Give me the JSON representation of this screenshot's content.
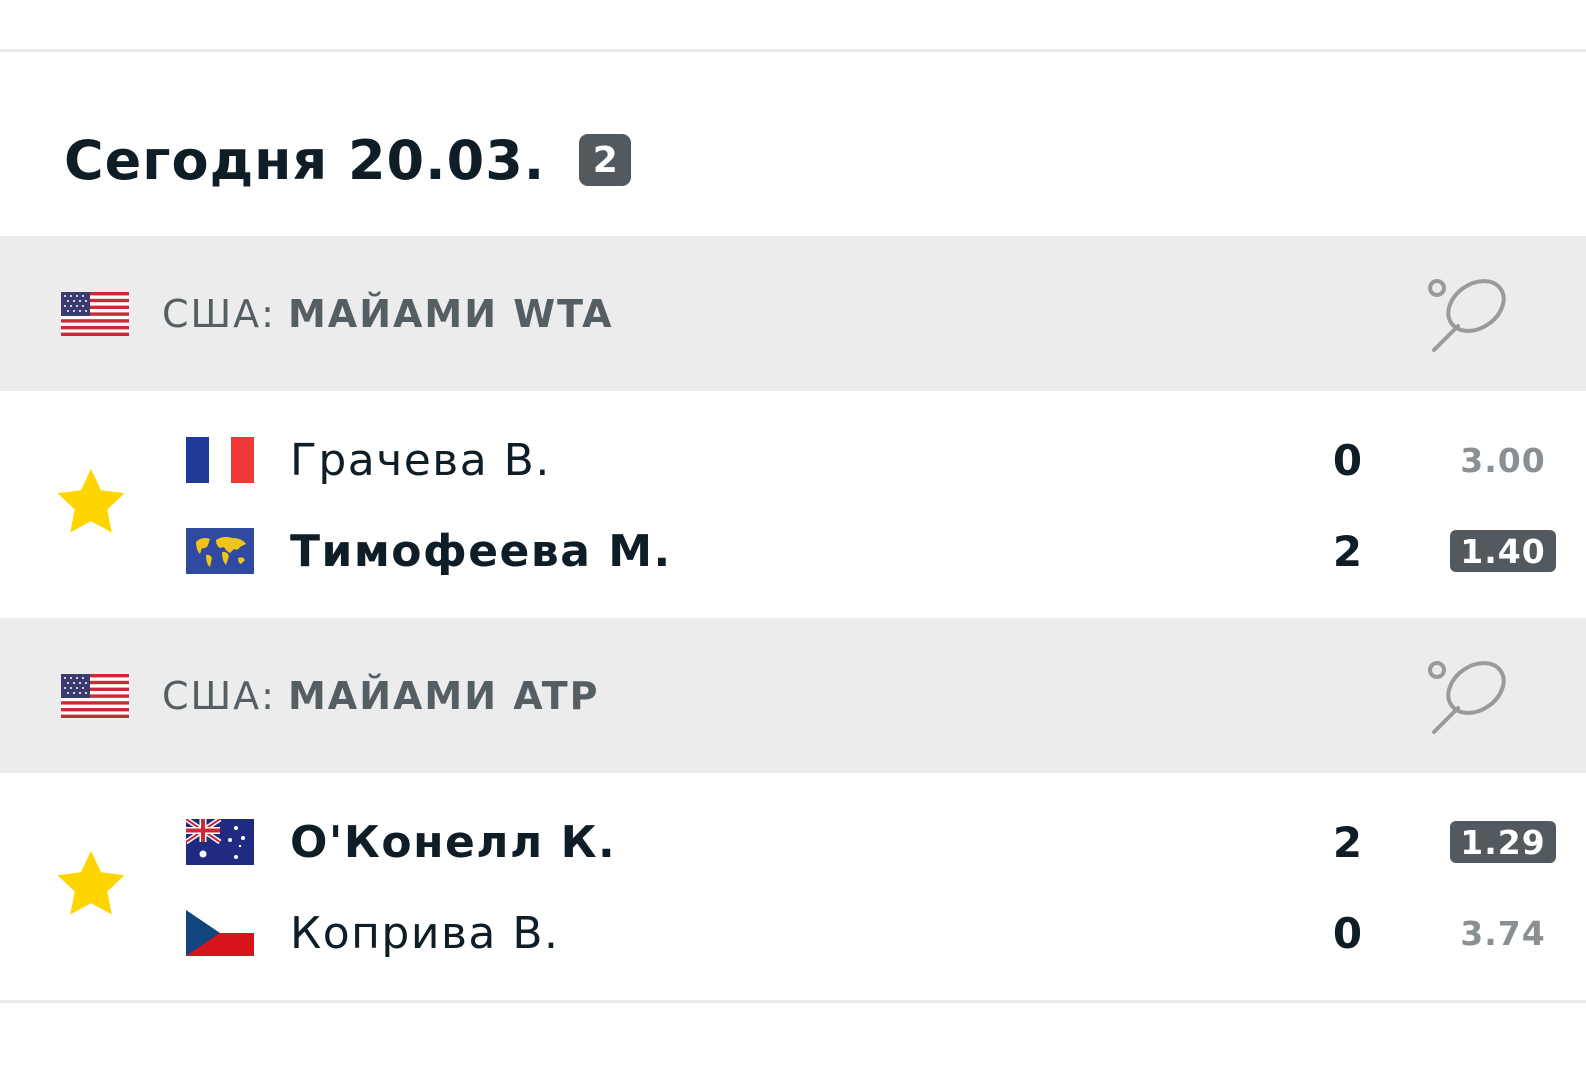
{
  "day": {
    "title": "Сегодня 20.03.",
    "count": "2"
  },
  "leagues": [
    {
      "country": "США:",
      "tournament": "МАЙАМИ WTA",
      "flag": "usa-flag",
      "sport_icon": "tennis-racket-icon",
      "match": {
        "favorite": true,
        "players": [
          {
            "name": "Грачева В.",
            "flag": "france-flag",
            "score": "0",
            "odds": "3.00",
            "winner": false
          },
          {
            "name": "Тимофеева М.",
            "flag": "world-flag",
            "score": "2",
            "odds": "1.40",
            "winner": true
          }
        ]
      }
    },
    {
      "country": "США:",
      "tournament": "МАЙАМИ ATP",
      "flag": "usa-flag",
      "sport_icon": "tennis-racket-icon",
      "match": {
        "favorite": true,
        "players": [
          {
            "name": "O'Конелл К.",
            "flag": "australia-flag",
            "score": "2",
            "odds": "1.29",
            "winner": true
          },
          {
            "name": "Коприва В.",
            "flag": "czech-flag",
            "score": "0",
            "odds": "3.74",
            "winner": false
          }
        ]
      }
    }
  ],
  "colors": {
    "header_bg": "#ececec",
    "star": "#ffd500",
    "badge_bg": "#525a5f",
    "text_dark": "#0f1e26",
    "text_muted": "#8a8f93"
  }
}
